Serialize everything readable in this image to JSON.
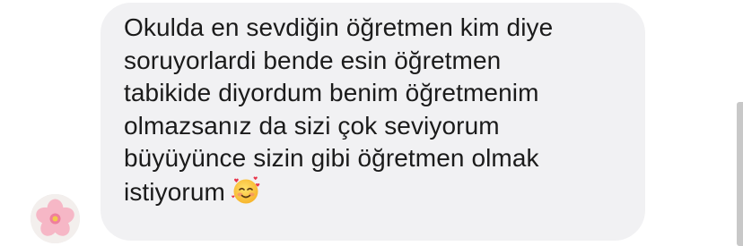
{
  "conversation": {
    "message": {
      "lines": [
        "Okulda en sevdiğin öğretmen kim diye",
        "soruyorlardi bende esin öğretmen",
        "tabikide diyordum benim öğretmenim",
        "olmazsanız da sizi çok seviyorum",
        "büyüyünce sizin gibi öğretmen olmak",
        "istiyorum"
      ],
      "emoji": "smiling-face-with-hearts",
      "bubble_color": "#f1f1f3",
      "text_color": "#1b1b1b"
    },
    "sender": {
      "avatar_icon": "pink-flower-avatar"
    }
  }
}
